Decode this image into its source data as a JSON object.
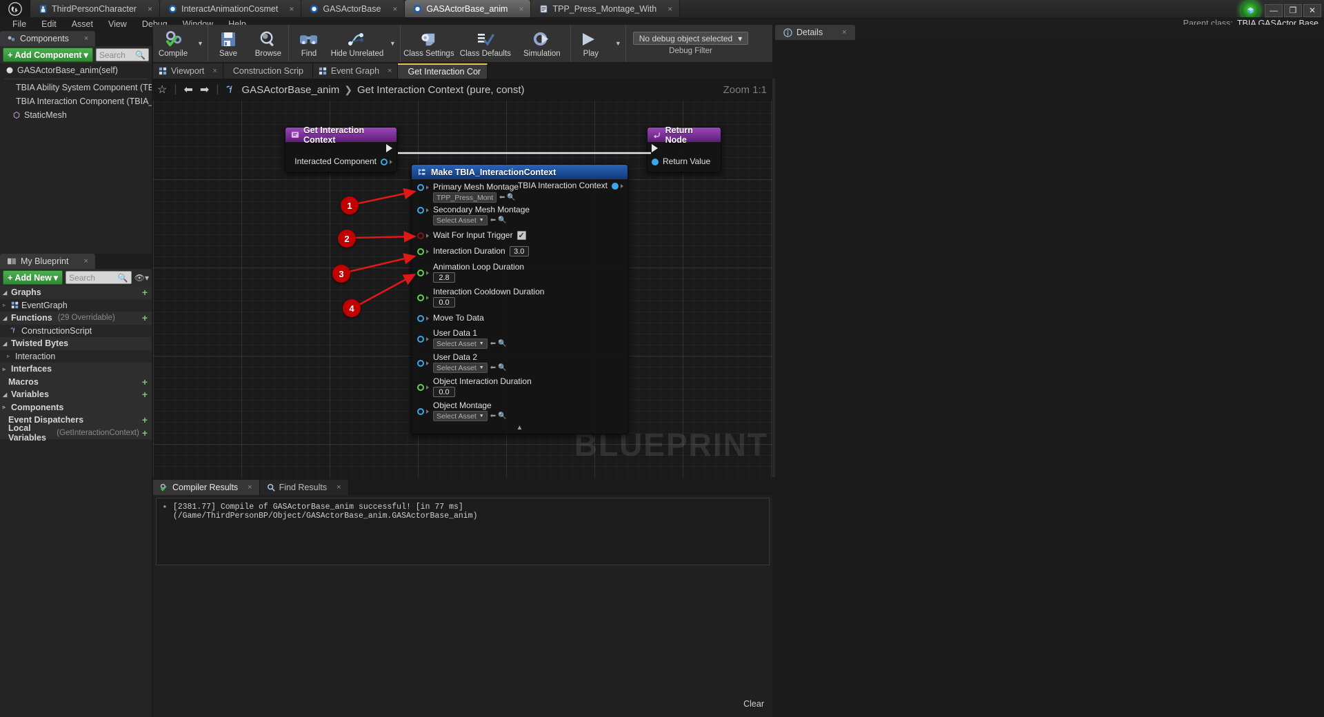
{
  "window": {
    "tabs": [
      {
        "label": "ThirdPersonCharacter",
        "icon": "character-icon",
        "active": false
      },
      {
        "label": "InteractAnimationCosmet",
        "icon": "blueprint-icon",
        "active": false
      },
      {
        "label": "GASActorBase",
        "icon": "blueprint-icon",
        "active": false
      },
      {
        "label": "GASActorBase_anim",
        "icon": "blueprint-icon",
        "active": true
      },
      {
        "label": "TPP_Press_Montage_With",
        "icon": "montage-icon",
        "active": false
      }
    ],
    "close_glyph": "×",
    "minimize": "—",
    "maximize": "❐",
    "close": "✕",
    "parent_class_label": "Parent class:",
    "parent_class_value": "TBIA GASActor Base"
  },
  "menu": {
    "items": [
      "File",
      "Edit",
      "Asset",
      "View",
      "Debug",
      "Window",
      "Help"
    ]
  },
  "components_panel": {
    "title": "Components",
    "close_glyph": "×",
    "add_component_label": "Add Component",
    "add_caret": "▾",
    "search_placeholder": "Search",
    "search_icon": "search-icon",
    "items": [
      {
        "label": "GASActorBase_anim(self)",
        "icon": "sphere-icon",
        "indent": 0
      },
      {
        "label": "TBIA Ability System Component (TBIA_Ab",
        "icon": "ability-icon",
        "indent": 1
      },
      {
        "label": "TBIA Interaction Component (TBIA_Intera",
        "icon": "interaction-icon",
        "indent": 1
      },
      {
        "label": "StaticMesh",
        "icon": "staticmesh-icon",
        "indent": 1
      }
    ]
  },
  "my_blueprint_panel": {
    "title": "My Blueprint",
    "close_glyph": "×",
    "add_new_label": "Add New",
    "add_caret": "▾",
    "search_placeholder": "Search",
    "search_icon": "search-icon",
    "eye_icon": "eye-icon",
    "rows": [
      {
        "label": "Graphs",
        "type": "cat",
        "expander": "◢",
        "plus": "+"
      },
      {
        "label": "EventGraph",
        "type": "sub",
        "expander": "▹",
        "icon": "graph-icon"
      },
      {
        "label": "Functions",
        "type": "cat",
        "expander": "◢",
        "note": "(29 Overridable)",
        "plus": "+"
      },
      {
        "label": "ConstructionScript",
        "type": "sub",
        "icon": "function-icon"
      },
      {
        "label": "Twisted Bytes",
        "type": "cat",
        "expander": "◢"
      },
      {
        "label": "Interaction",
        "type": "sub",
        "expander": "▹"
      },
      {
        "label": "Interfaces",
        "type": "cat",
        "expander": "▹"
      },
      {
        "label": "Macros",
        "type": "cat",
        "plus": "+"
      },
      {
        "label": "Variables",
        "type": "cat",
        "expander": "◢",
        "plus": "+"
      },
      {
        "label": "Components",
        "type": "cat",
        "expander": "▹"
      },
      {
        "label": "Event Dispatchers",
        "type": "cat",
        "plus": "+"
      },
      {
        "label": "Local Variables",
        "type": "cat",
        "note": "(GetInteractionContext)",
        "plus": "+"
      }
    ]
  },
  "toolbar": {
    "buttons": [
      {
        "label": "Compile",
        "icon": "compile-icon",
        "caret": true
      },
      {
        "label": "Save",
        "icon": "save-icon"
      },
      {
        "label": "Browse",
        "icon": "browse-icon"
      },
      {
        "label": "Find",
        "icon": "find-icon"
      },
      {
        "label": "Hide Unrelated",
        "icon": "hide-unrelated-icon",
        "caret": true
      },
      {
        "label": "Class Settings",
        "icon": "class-settings-icon"
      },
      {
        "label": "Class Defaults",
        "icon": "class-defaults-icon"
      },
      {
        "label": "Simulation",
        "icon": "simulation-icon"
      },
      {
        "label": "Play",
        "icon": "play-icon",
        "caret": true
      }
    ],
    "debug_object_value": "No debug object selected",
    "debug_caret": "▾",
    "debug_filter_label": "Debug Filter"
  },
  "graph_tabs": [
    {
      "label": "Viewport",
      "icon": "viewport-icon",
      "active": false
    },
    {
      "label": "Construction Scrip",
      "icon": "function-icon",
      "active": false
    },
    {
      "label": "Event Graph",
      "icon": "graph-icon",
      "active": false
    },
    {
      "label": "Get Interaction Cor",
      "icon": "function-icon",
      "active": true
    }
  ],
  "graph": {
    "star_icon": "favorite-star-icon",
    "back_icon": "back-arrow-icon",
    "forward_icon": "forward-arrow-icon",
    "function_icon": "function-icon",
    "breadcrumb_root": "GASActorBase_anim",
    "breadcrumb_sep": "❯",
    "breadcrumb_current": "Get Interaction Context (pure, const)",
    "zoom_label": "Zoom 1:1",
    "watermark": "BLUEPRINT",
    "nodes": [
      {
        "id": "get-interaction-context",
        "title": "Get Interaction Context",
        "header_color": "#7a2a96",
        "icon": "function-node-icon",
        "outputs": [
          {
            "label": "",
            "kind": "exec"
          },
          {
            "label": "Interacted Component",
            "kind": "object",
            "color": "#3aa7e8"
          }
        ]
      },
      {
        "id": "make-tbia-interactioncontext",
        "title": "Make TBIA_InteractionContext",
        "header_color": "#1c4f99",
        "icon": "make-struct-icon",
        "collapse_glyph": "▲",
        "output_pin": {
          "label": "TBIA Interaction Context",
          "color": "#3aa7e8"
        },
        "inputs": [
          {
            "label": "Primary Mesh Montage",
            "color": "#3aa7e8",
            "widget": "asset",
            "value": "TPP_Press_Mont"
          },
          {
            "label": "Secondary Mesh Montage",
            "color": "#3aa7e8",
            "widget": "asset",
            "value": "Select Asset"
          },
          {
            "label": "Wait For Input Trigger",
            "color": "#8c1111",
            "widget": "checkbox",
            "value": "✓"
          },
          {
            "label": "Interaction Duration",
            "color": "#5fd44a",
            "widget": "number",
            "value": "3.0"
          },
          {
            "label": "Animation Loop Duration",
            "color": "#5fd44a",
            "widget": "number-below",
            "value": "2.8"
          },
          {
            "label": "Interaction Cooldown Duration",
            "color": "#5fd44a",
            "widget": "number-below",
            "value": "0.0"
          },
          {
            "label": "Move To Data",
            "color": "#3aa7e8",
            "widget": "none",
            "value": ""
          },
          {
            "label": "User Data 1",
            "color": "#3aa7e8",
            "widget": "asset-below",
            "value": "Select Asset"
          },
          {
            "label": "User Data 2",
            "color": "#3aa7e8",
            "widget": "asset-below",
            "value": "Select Asset"
          },
          {
            "label": "Object Interaction Duration",
            "color": "#5fd44a",
            "widget": "number-below",
            "value": "0.0"
          },
          {
            "label": "Object Montage",
            "color": "#3aa7e8",
            "widget": "asset-below",
            "value": "Select Asset"
          }
        ]
      },
      {
        "id": "return-node",
        "title": "Return Node",
        "header_color": "#7a2a96",
        "icon": "return-node-icon",
        "inputs": [
          {
            "label": "",
            "kind": "exec"
          },
          {
            "label": "Return Value",
            "kind": "object",
            "color": "#3aa7e8"
          }
        ]
      }
    ],
    "callouts": [
      {
        "number": "1",
        "target": "Primary Mesh Montage"
      },
      {
        "number": "2",
        "target": "Wait For Input Trigger"
      },
      {
        "number": "3",
        "target": "Interaction Duration"
      },
      {
        "number": "4",
        "target": "Animation Loop Duration"
      }
    ]
  },
  "details_panel": {
    "title": "Details",
    "icon": "info-icon",
    "close_glyph": "×"
  },
  "results_panel": {
    "tabs": [
      {
        "label": "Compiler Results",
        "icon": "compiler-icon",
        "active": true
      },
      {
        "label": "Find Results",
        "icon": "find-results-icon",
        "active": false
      }
    ],
    "close_glyph": "×",
    "bullet": "•",
    "message": "[2381.77] Compile of GASActorBase_anim successful! [in 77 ms] (/Game/ThirdPersonBP/Object/GASActorBase_anim.GASActorBase_anim)",
    "clear_label": "Clear"
  }
}
